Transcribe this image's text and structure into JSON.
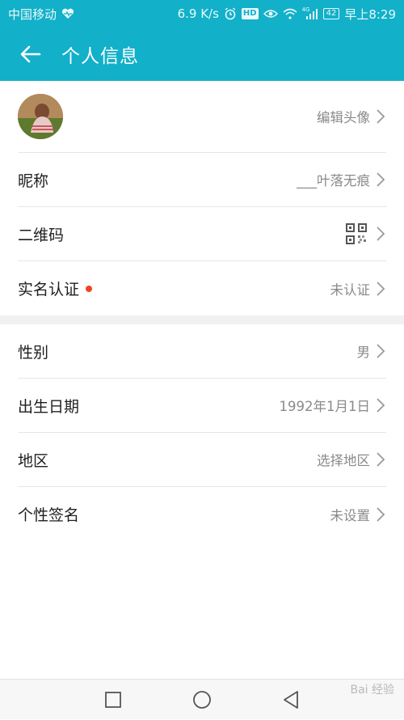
{
  "status_bar": {
    "carrier": "中国移动",
    "speed": "6.9 K/s",
    "hd_label": "HD",
    "signal_tag": "4G",
    "battery": "42",
    "time": "早上8:29",
    "icons": [
      "heart-icon",
      "alarm-icon",
      "hd-icon",
      "eye-icon",
      "wifi-icon",
      "signal-icon",
      "battery-icon"
    ]
  },
  "app_bar": {
    "back_icon": "arrow-left-icon",
    "title": "个人信息"
  },
  "profile_rows": [
    {
      "label": "",
      "value": "编辑头像",
      "type": "avatar"
    },
    {
      "label": "昵称",
      "value": "___叶落无痕"
    },
    {
      "label": "二维码",
      "value": "",
      "type": "qr"
    },
    {
      "label": "实名认证",
      "value": "未认证",
      "badge": "red-dot"
    }
  ],
  "detail_rows": [
    {
      "label": "性别",
      "value": "男"
    },
    {
      "label": "出生日期",
      "value": "1992年1月1日"
    },
    {
      "label": "地区",
      "value": "选择地区"
    },
    {
      "label": "个性签名",
      "value": "未设置"
    }
  ],
  "nav_bar": {
    "buttons": [
      "recents-square-icon",
      "home-circle-icon",
      "back-triangle-icon"
    ]
  },
  "watermark": "Bai 经验",
  "colors": {
    "accent": "#12b0c9",
    "badge": "#f0441e",
    "value_text": "#8a8a8a"
  }
}
